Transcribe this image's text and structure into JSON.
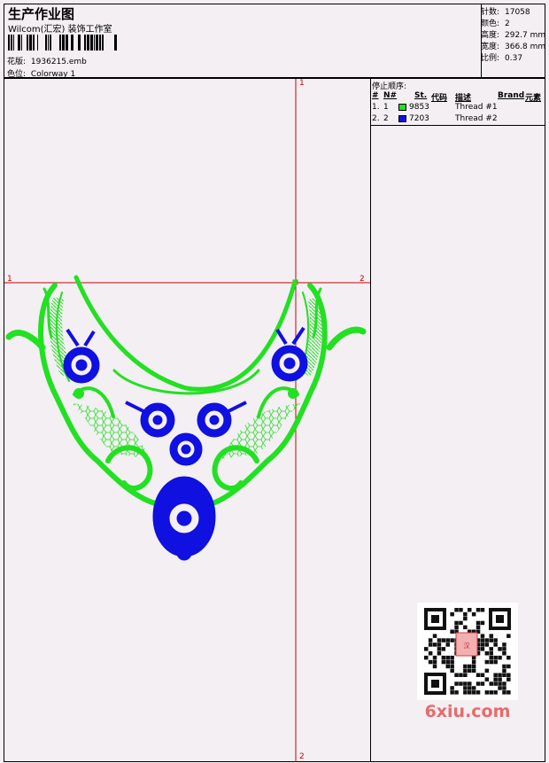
{
  "header": {
    "title": "生产作业图",
    "subtitle": "Wilcom(汇宏) 装饰工作室",
    "design_label": "花版:",
    "design_value": "1936215.emb",
    "colorway_label": "色位:",
    "colorway_value": "Colorway 1"
  },
  "stats": [
    {
      "label": "针数:",
      "value": "17058"
    },
    {
      "label": "颜色:",
      "value": "2"
    },
    {
      "label": "高度:",
      "value": "292.7 mm"
    },
    {
      "label": "宽度:",
      "value": "366.8 mm"
    },
    {
      "label": "比例:",
      "value": "0.37"
    }
  ],
  "stop_sequence": {
    "heading": "停止顺序:",
    "columns": [
      "#",
      "N#",
      "St.",
      "代码",
      "描述",
      "Brand",
      "元素"
    ],
    "rows": [
      {
        "num": "1.",
        "n": "1",
        "color": "#22e022",
        "code": "9853",
        "desc": "Thread #1"
      },
      {
        "num": "2.",
        "n": "2",
        "color": "#1010e0",
        "code": "7203",
        "desc": "Thread #2"
      }
    ]
  },
  "axis_labels": {
    "top": "1",
    "bottom": "2",
    "left": "1",
    "right": "2"
  },
  "watermark": {
    "text": "6xiu.com",
    "seal": "汉画图谱"
  },
  "colors": {
    "thread1": "#22e022",
    "thread2": "#1010e0",
    "guide": "#cc0000",
    "background": "#f3eff3"
  }
}
